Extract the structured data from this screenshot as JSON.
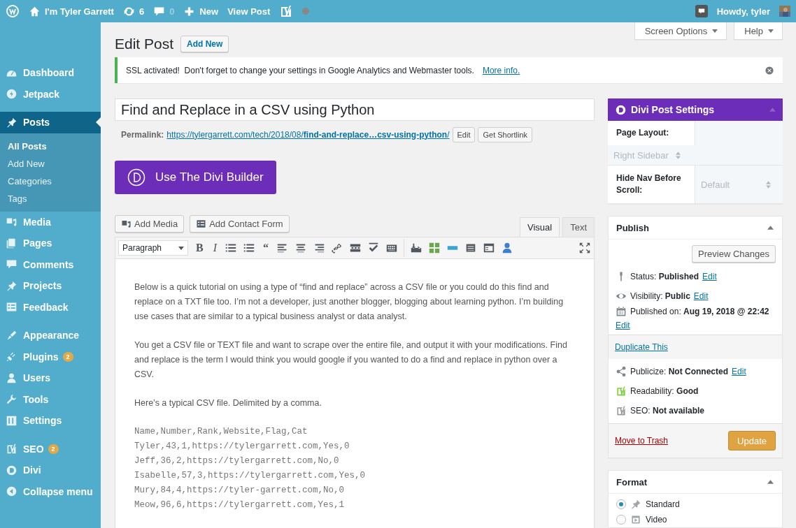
{
  "admin_bar": {
    "site": "I'm Tyler Garrett",
    "updates": "6",
    "comments": "0",
    "new": "New",
    "view": "View Post",
    "greeting": "Howdy, tyler"
  },
  "sidebar": {
    "groups": [
      [
        {
          "label": "Dashboard",
          "selected": false
        },
        {
          "label": "Jetpack",
          "selected": false
        }
      ],
      [
        {
          "label": "Posts",
          "selected": true,
          "children": [
            {
              "label": "All Posts",
              "selected": true
            },
            {
              "label": "Add New",
              "selected": false
            },
            {
              "label": "Categories",
              "selected": false
            },
            {
              "label": "Tags",
              "selected": false
            }
          ]
        },
        {
          "label": "Media",
          "selected": false
        },
        {
          "label": "Pages",
          "selected": false
        },
        {
          "label": "Comments",
          "selected": false
        },
        {
          "label": "Projects",
          "selected": false
        },
        {
          "label": "Feedback",
          "selected": false
        }
      ],
      [
        {
          "label": "Appearance",
          "selected": false
        },
        {
          "label": "Plugins",
          "selected": false,
          "badge": "2"
        },
        {
          "label": "Users",
          "selected": false
        },
        {
          "label": "Tools",
          "selected": false
        },
        {
          "label": "Settings",
          "selected": false
        }
      ],
      [
        {
          "label": "SEO",
          "selected": false,
          "badge": "2"
        },
        {
          "label": "Divi",
          "selected": false
        },
        {
          "label": "Collapse menu",
          "selected": false
        }
      ]
    ]
  },
  "screen_tabs": [
    "Screen Options",
    "Help"
  ],
  "heading": "Edit Post",
  "add_new": "Add New",
  "notice": {
    "text": "SSL activated!  Don't forget to change your settings in Google Analytics and Webmaster tools.",
    "link": "More info."
  },
  "post_title": "Find and Replace in a CSV using Python",
  "permalink": {
    "label": "Permalink:",
    "url": "https://tylergarrett.com/tech/2018/08/**find-and-replace…csv-using-python**/",
    "buttons": [
      "Edit",
      "Get Shortlink"
    ]
  },
  "divi_builder": "Use The Divi Builder",
  "media_buttons": [
    "Add Media",
    "Add Contact Form"
  ],
  "editor_tabs": [
    {
      "label": "Visual",
      "selected": true
    },
    {
      "label": "Text",
      "selected": false
    }
  ],
  "format_select": "Paragraph",
  "toolbar": [
    {
      "kind": "text",
      "label": "B"
    },
    {
      "kind": "italic",
      "label": "I"
    },
    {
      "kind": "icon"
    },
    {
      "kind": "icon"
    },
    {
      "kind": "text",
      "label": "“"
    },
    {
      "kind": "icon"
    },
    {
      "kind": "icon"
    },
    {
      "kind": "icon"
    },
    {
      "kind": "icon"
    },
    {
      "kind": "icon"
    },
    {
      "kind": "icon"
    },
    {
      "kind": "icon"
    },
    {
      "kind": "icon"
    },
    {
      "kind": "icon"
    },
    {
      "kind": "icon"
    },
    {
      "kind": "icon"
    },
    {
      "kind": "icon"
    },
    {
      "kind": "icon"
    },
    {
      "kind": "icon"
    }
  ],
  "content": [
    {
      "kind": "paragraph",
      "text": "Below is a quick tutorial on using a type of “find and replace” across a CSV file or you could do this find and replace on a TXT file too. I’m not a developer, just another blogger, blogging about learning python. I’m building use cases that are similar to a typical business analyst or data analyst."
    },
    {
      "kind": "paragraph",
      "text": "You get a CSV file or TEXT file and want to scrape over the entire file, and output it with your modifications. Find and replace is the term I would think you would google if you wanted to do a find and replace in python over a CSV."
    },
    {
      "kind": "paragraph",
      "text": "Here’s a typical CSV file. Delimited by a comma."
    },
    {
      "kind": "code",
      "lines": [
        "Name,Number,Rank,Website,Flag,Cat",
        "Tyler,43,1,https://tylergarrett.com,Yes,0",
        "Jeff,36,2,https://tylergarrett.com,No,0",
        "Isabelle,57,3,https://tylergarrett.com,Yes,0",
        "Mury,84,4,https://tyler-garrett.com,No,0",
        "Meow,96,6,https://tylergarrett.com,Yes,1"
      ]
    }
  ],
  "divi_settings": {
    "title": "Divi Post Settings",
    "fields": [
      {
        "kind": "stacked",
        "label": "Page Layout:",
        "value": "Right Sidebar"
      },
      {
        "kind": "inline",
        "label": "Hide Nav Before Scroll:",
        "value": "Default"
      }
    ]
  },
  "publish": {
    "title": "Publish",
    "preview": "Preview Changes",
    "misc": [
      {
        "text": "Status: **Published**",
        "link": "Edit"
      },
      {
        "text": "Visibility: **Public**",
        "link": "Edit"
      },
      {
        "text": "Published on: **Aug 19, 2018 @ 22:42**",
        "link": "Edit",
        "link_below": true
      }
    ],
    "duplicate": "Duplicate This",
    "extra": [
      {
        "kind": "share",
        "text": "Publicize: **Not Connected**",
        "link": "Edit"
      },
      {
        "kind": "yoast",
        "color": "#7ad03a",
        "text": "Readability: **Good**"
      },
      {
        "kind": "yoast",
        "color": "#999999",
        "text": "SEO: **Not available**"
      }
    ],
    "trash": "Move to Trash",
    "update": "Update"
  },
  "format": {
    "title": "Format",
    "options": [
      {
        "label": "Standard",
        "selected": true
      },
      {
        "label": "Video",
        "selected": false
      }
    ]
  }
}
